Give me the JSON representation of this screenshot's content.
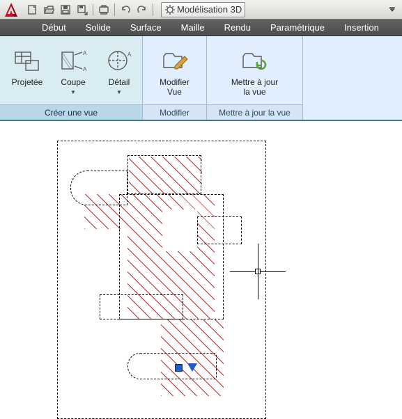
{
  "workspace": {
    "label": "Modélisation 3D"
  },
  "tabs": {
    "debut": "Début",
    "solide": "Solide",
    "surface": "Surface",
    "maille": "Maille",
    "rendu": "Rendu",
    "parametrique": "Paramétrique",
    "insertion": "Insertion"
  },
  "ribbon": {
    "panel_creer": "Créer une vue",
    "panel_modifier": "Modifier",
    "panel_maj": "Mettre à jour la vue",
    "projetee": "Projetée",
    "coupe": "Coupe",
    "detail": "Détail",
    "modifier_vue": "Modifier\nVue",
    "maj_vue": "Mettre à jour\nla vue"
  }
}
